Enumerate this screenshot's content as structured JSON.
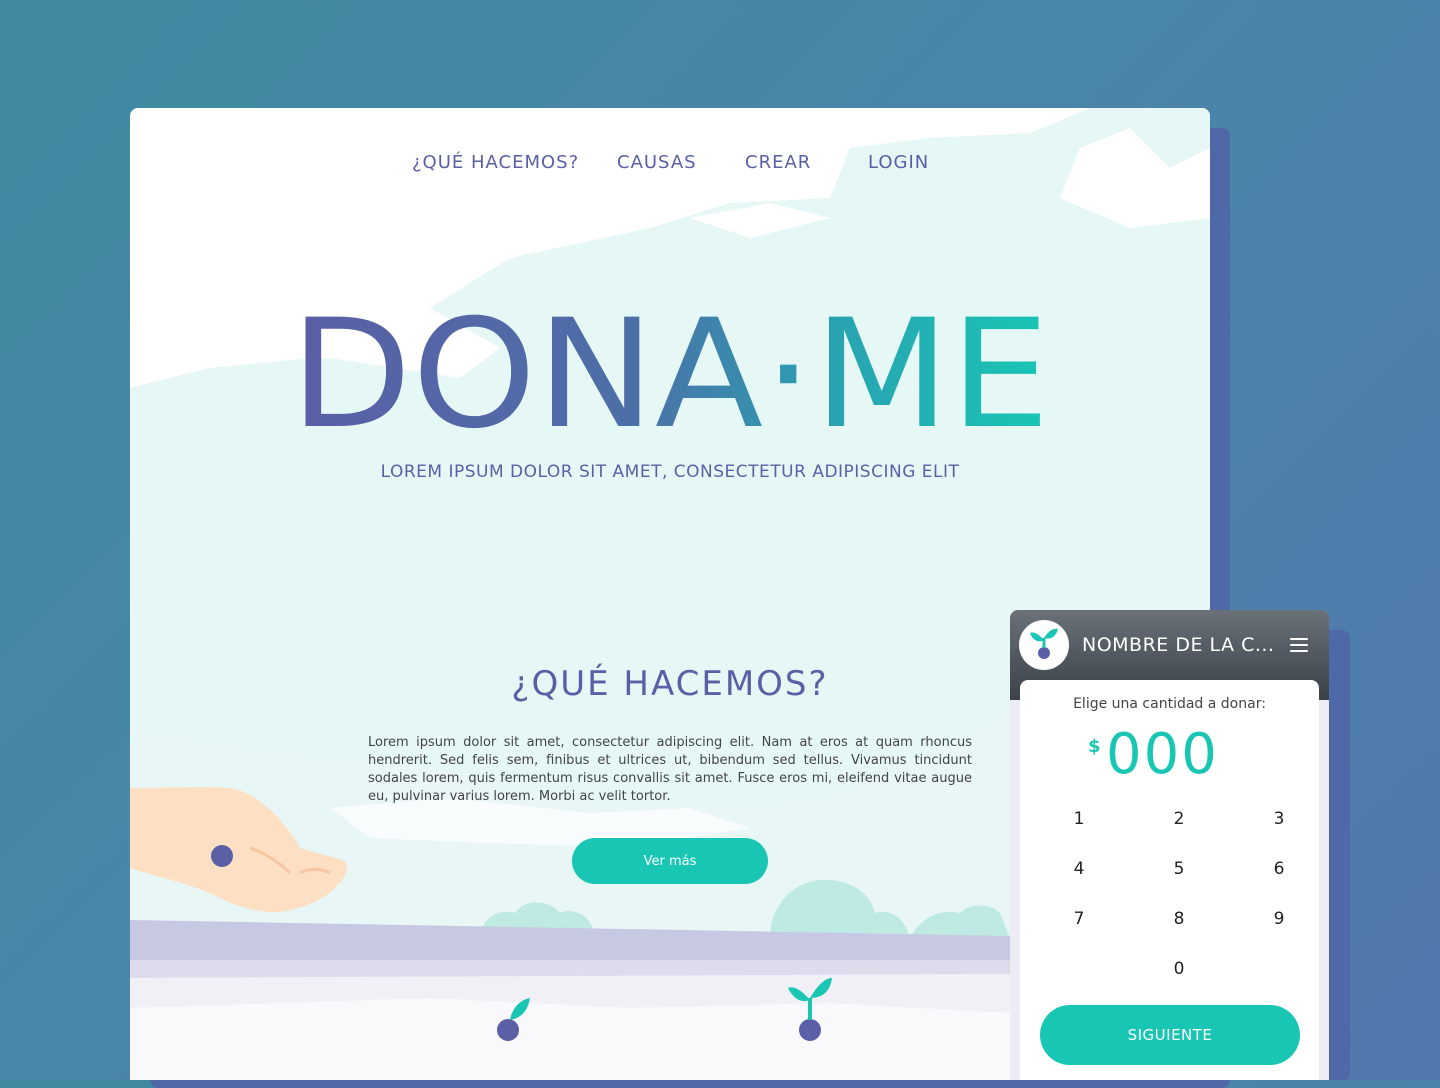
{
  "nav": {
    "items": [
      {
        "label": "¿QUÉ HACEMOS?"
      },
      {
        "label": "CAUSAS"
      },
      {
        "label": "CREAR"
      },
      {
        "label": "LOGIN"
      }
    ]
  },
  "hero": {
    "logo_text": "DONA·ME",
    "tagline": "LOREM IPSUM DOLOR SIT AMET, CONSECTETUR ADIPISCING ELIT"
  },
  "section": {
    "title": "¿QUÉ HACEMOS?",
    "body": "Lorem ipsum dolor sit amet, consectetur adipiscing elit. Nam at eros at quam rhoncus hendrerit. Sed felis sem, finibus et ultrices ut, bibendum sed tellus. Vivamus tincidunt sodales lorem, quis fermentum risus convallis sit amet. Fusce eros mi, eleifend vitae augue eu, pulvinar varius lorem. Morbi ac velit tortor.",
    "button_label": "Ver más"
  },
  "phone": {
    "title": "NOMBRE DE LA C...",
    "prompt": "Elige una cantidad a donar:",
    "currency": "$",
    "amount": "000",
    "keys": [
      "1",
      "2",
      "3",
      "4",
      "5",
      "6",
      "7",
      "8",
      "9",
      "0"
    ],
    "next_label": "SIGUIENTE"
  },
  "colors": {
    "primary": "#5a5fa6",
    "accent": "#19c6b4",
    "sky": "#e6f8f6",
    "card_shadow": "#4f68a8"
  },
  "icons": [
    "hamburger-menu-icon",
    "sprout-logo-icon"
  ]
}
